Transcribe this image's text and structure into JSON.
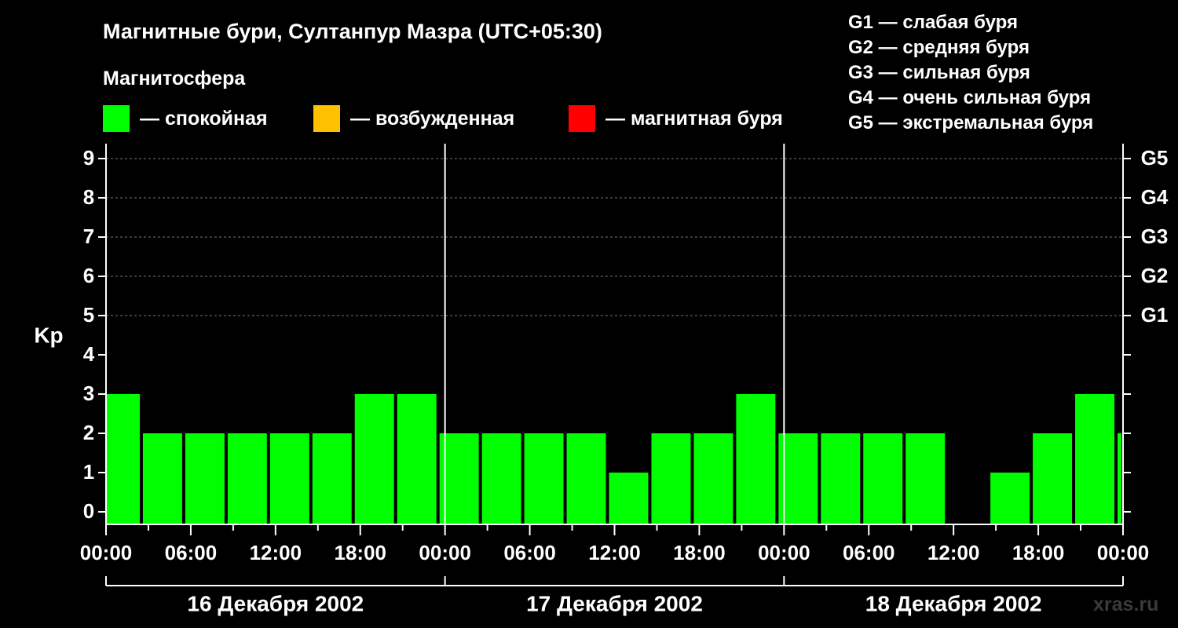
{
  "header": {
    "title": "Магнитные бури, Султанпур Мазра (UTC+05:30)",
    "subtitle": "Магнитосфера"
  },
  "legend": [
    {
      "label": "— спокойная",
      "color": "#00ff00"
    },
    {
      "label": "— возбужденная",
      "color": "#ffc000"
    },
    {
      "label": "— магнитная буря",
      "color": "#ff0000"
    }
  ],
  "storm_scale": [
    "G1 — слабая буря",
    "G2 — средняя буря",
    "G3 — сильная буря",
    "G4 — очень сильная буря",
    "G5 — экстремальная буря"
  ],
  "watermark": "xras.ru",
  "colors": {
    "background": "#000000",
    "foreground": "#ffffff",
    "grid": "#777777",
    "quiet": "#00ff00",
    "active": "#ffc000",
    "storm": "#ff0000"
  },
  "chart_data": {
    "type": "bar",
    "title": "Магнитные бури, Султанпур Мазра (UTC+05:30)",
    "ylabel": "Kp",
    "ylim": [
      0,
      9
    ],
    "yticks": [
      "0",
      "1",
      "2",
      "3",
      "4",
      "5",
      "6",
      "7",
      "8",
      "9"
    ],
    "right_axis": [
      {
        "kp": 5,
        "label": "G1"
      },
      {
        "kp": 6,
        "label": "G2"
      },
      {
        "kp": 7,
        "label": "G3"
      },
      {
        "kp": 8,
        "label": "G4"
      },
      {
        "kp": 9,
        "label": "G5"
      }
    ],
    "x_tick_labels": [
      "00:00",
      "06:00",
      "12:00",
      "18:00",
      "00:00",
      "06:00",
      "12:00",
      "18:00",
      "00:00",
      "06:00",
      "12:00",
      "18:00",
      "00:00"
    ],
    "days": [
      "16 Декабря 2002",
      "17 Декабря 2002",
      "18 Декабря 2002"
    ],
    "hours_per_bar": 3,
    "start_hour_offset": -0.5,
    "values": [
      3,
      2,
      2,
      2,
      2,
      2,
      3,
      3,
      2,
      2,
      2,
      2,
      1,
      2,
      2,
      3,
      2,
      2,
      2,
      2,
      0,
      1,
      2,
      3,
      2
    ],
    "grid": true,
    "legend_position": "top"
  }
}
